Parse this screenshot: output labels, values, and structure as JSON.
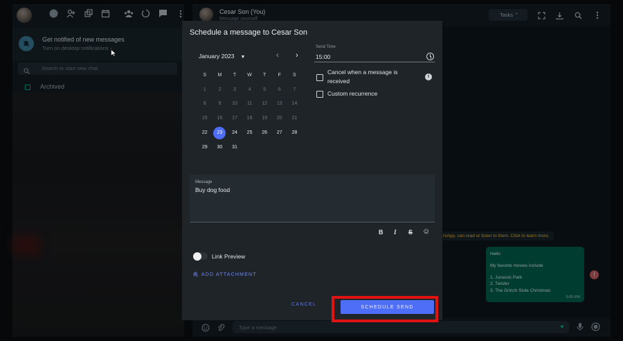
{
  "sidebar": {
    "notification": {
      "title": "Get notified of new messages",
      "subtitle": "Turn on desktop notifications ›"
    },
    "search_placeholder": "Search or start new chat",
    "archived_label": "Archived"
  },
  "chat": {
    "contact_name": "Cesar Son (You)",
    "contact_subtitle": "Message yourself",
    "tasks_label": "Tasks",
    "encryption_notice": "rsApp, can read or listen to them. Click to learn more.",
    "bubble_lines": [
      "Hello",
      "My favorite movies include",
      "1. Jurassic Park",
      "2. Twister",
      "3. The Grinch Stole Christmas"
    ],
    "bubble_time": "5:05 PM",
    "error_badge": "!",
    "composer_placeholder": "Type a message"
  },
  "dialog": {
    "title": "Schedule a message to Cesar Son",
    "month_label": "January 2023",
    "weekdays": [
      "S",
      "M",
      "T",
      "W",
      "T",
      "F",
      "S"
    ],
    "weeks": [
      [
        "1",
        "2",
        "3",
        "4",
        "5",
        "6",
        "7"
      ],
      [
        "8",
        "9",
        "10",
        "11",
        "12",
        "13",
        "14"
      ],
      [
        "15",
        "16",
        "17",
        "18",
        "19",
        "20",
        "21"
      ],
      [
        "22",
        "23",
        "24",
        "25",
        "26",
        "27",
        "28"
      ],
      [
        "29",
        "30",
        "31",
        "",
        "",
        "",
        ""
      ]
    ],
    "selected_day": "23",
    "first_enabled_day": 22,
    "send_time_label": "Send Time",
    "send_time_value": "15:00",
    "cancel_on_reply_label": "Cancel when a message is received",
    "custom_recurrence_label": "Custom recurrence",
    "message_label": "Message",
    "message_value": "Buy dog food",
    "format_buttons": [
      "B",
      "I",
      "S",
      "☺"
    ],
    "link_preview_label": "Link Preview",
    "add_attachment_label": "ADD ATTACHMENT",
    "cancel_label": "CANCEL",
    "schedule_send_label": "SCHEDULE SEND"
  },
  "colors": {
    "accent": "#4f6ef7",
    "highlight": "#e01313",
    "bubble": "#005c4b"
  }
}
